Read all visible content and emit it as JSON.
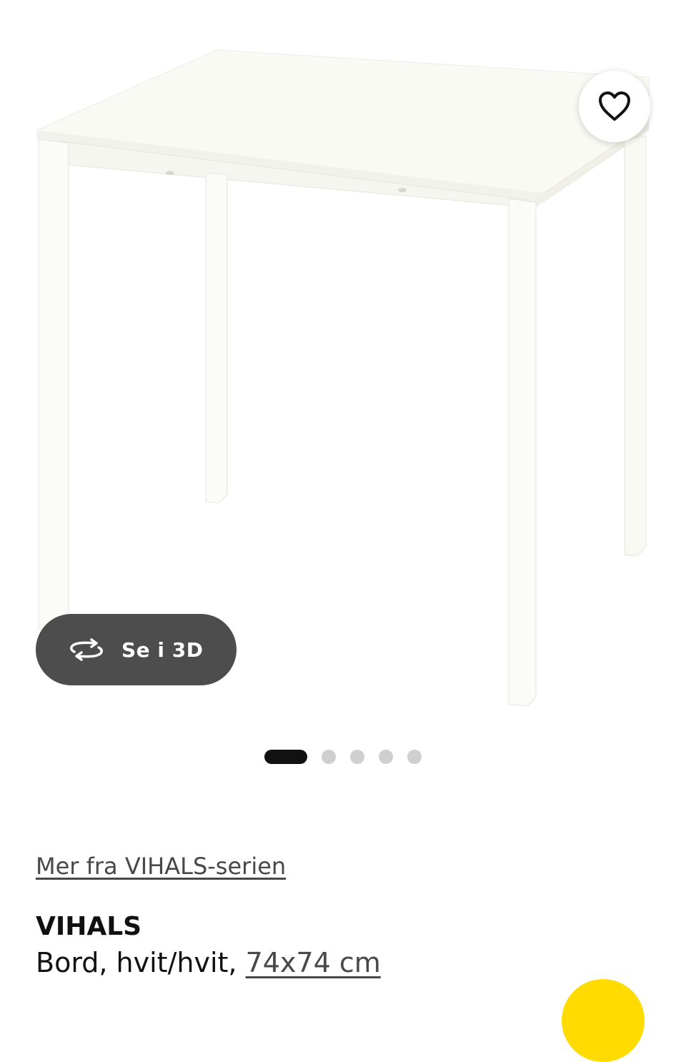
{
  "gallery": {
    "image_alt": "VIHALS Bord, hvit/hvit",
    "slide_count": 5,
    "active_slide": 1,
    "favorite_icon": "heart-outline-icon",
    "view_3d": {
      "label": "Se i 3D",
      "icon": "rotate-3d-icon"
    }
  },
  "product": {
    "series_link": "Mer fra VIHALS-serien",
    "name": "VIHALS",
    "description": "Bord, hvit/hvit, ",
    "size": "74x74 cm"
  },
  "colors": {
    "accent_yellow": "#ffdb00",
    "button_dark": "#4d4d4d",
    "active_dot": "#111111",
    "inactive_dot": "#cfcfcf",
    "link": "#484848"
  }
}
